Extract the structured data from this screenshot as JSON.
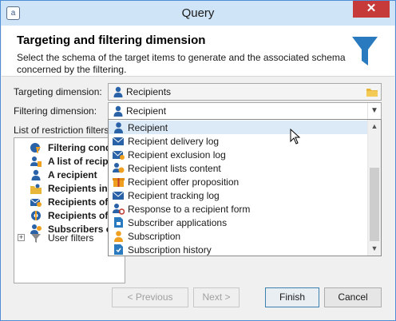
{
  "window": {
    "title": "Query",
    "close_label": "✕",
    "app_icon_glyph": "a"
  },
  "header": {
    "title": "Targeting and filtering dimension",
    "description": "Select the schema of the target items to  generate and the associated schema concerned by the filtering.",
    "icon": "funnel-icon"
  },
  "targeting": {
    "label": "Targeting dimension:",
    "value": "Recipients",
    "icon": "person-icon"
  },
  "filtering": {
    "label": "Filtering dimension:",
    "value": "Recipient",
    "icon": "person-icon"
  },
  "restriction": {
    "label": "List of restriction filters",
    "items": [
      {
        "label": "Filtering cond",
        "icon": "filter-condition-icon"
      },
      {
        "label": "A list of recipi",
        "icon": "list-person-icon"
      },
      {
        "label": "A recipient",
        "icon": "person-icon"
      },
      {
        "label": "Recipients inc",
        "icon": "folder-person-icon"
      },
      {
        "label": "Recipients of",
        "icon": "mail-person-icon"
      },
      {
        "label": "Recipients of",
        "icon": "life-ring-icon"
      },
      {
        "label": "Subscribers of",
        "icon": "subscribers-icon"
      },
      {
        "label": "User filters",
        "icon": "funnel-icon",
        "expander": "+"
      }
    ]
  },
  "dropdown": {
    "items": [
      {
        "label": "Recipient",
        "icon": "person-icon",
        "selected": true
      },
      {
        "label": "Recipient delivery log",
        "icon": "mail-log-icon"
      },
      {
        "label": "Recipient exclusion log",
        "icon": "mail-exclusion-icon"
      },
      {
        "label": "Recipient lists content",
        "icon": "list-content-icon"
      },
      {
        "label": "Recipient offer proposition",
        "icon": "gift-icon"
      },
      {
        "label": "Recipient tracking log",
        "icon": "tracking-mail-icon"
      },
      {
        "label": "Response to a recipient form",
        "icon": "person-at-icon"
      },
      {
        "label": "Subscriber applications",
        "icon": "app-doc-icon"
      },
      {
        "label": "Subscription",
        "icon": "subscription-icon"
      },
      {
        "label": "Subscription history",
        "icon": "history-doc-icon"
      }
    ]
  },
  "buttons": {
    "previous": "< Previous",
    "next": "Next >",
    "finish": "Finish",
    "cancel": "Cancel"
  },
  "colors": {
    "accent": "#2a7ac0",
    "selection": "#dce9f6",
    "close": "#c73a3a",
    "titlebar": "#cfe4f7"
  }
}
